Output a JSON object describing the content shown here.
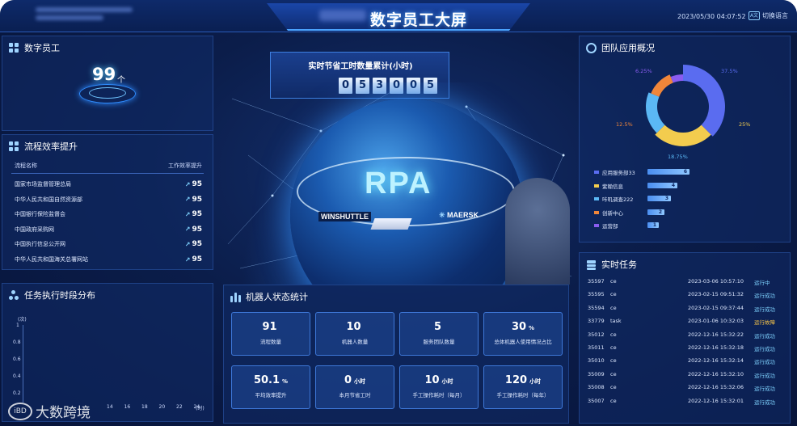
{
  "header": {
    "title": "数字员工大屏",
    "datetime": "2023/05/30 04:07:52",
    "lang_label": "切换语言",
    "lang_icon": "translate-icon"
  },
  "digital_workers": {
    "title": "数字员工",
    "count": "99",
    "unit": "个"
  },
  "process_efficiency": {
    "title": "流程效率提升",
    "columns": [
      "流程名称",
      "工作效率提升"
    ],
    "rows": [
      {
        "name": "国家市场监督管理总局",
        "value": "95"
      },
      {
        "name": "中华人民共和国自然资源部",
        "value": "95"
      },
      {
        "name": "中国银行保险监督会",
        "value": "95"
      },
      {
        "name": "中国政府采购网",
        "value": "95"
      },
      {
        "name": "中国执行信息公开网",
        "value": "95"
      },
      {
        "name": "中华人民共和国海关总署网站",
        "value": "95"
      }
    ]
  },
  "task_period": {
    "title": "任务执行时段分布",
    "chart_data": {
      "type": "line",
      "ylabel": "(次)",
      "y_ticks": [
        "1",
        "0.8",
        "0.6",
        "0.4",
        "0.2"
      ],
      "x_ticks": [
        "14",
        "16",
        "18",
        "20",
        "22",
        "24"
      ],
      "xlabel": "(时)",
      "ylim": [
        0,
        1
      ]
    }
  },
  "counter": {
    "title": "实时节省工时数量累计(小时)",
    "digits": [
      "0",
      "5",
      "3",
      "0",
      "0",
      "5"
    ]
  },
  "center": {
    "rpa_text": "RPA",
    "brand_left": "WINSHUTTLE",
    "brand_right": "MAERSK"
  },
  "robot_status": {
    "title": "机器人状态统计",
    "cards": [
      {
        "value": "91",
        "unit": "",
        "label": "流程数量"
      },
      {
        "value": "10",
        "unit": "",
        "label": "机器人数量"
      },
      {
        "value": "5",
        "unit": "",
        "label": "服务团队数量"
      },
      {
        "value": "30",
        "unit": "%",
        "label": "总体机器人使用情况占比"
      },
      {
        "value": "50.1",
        "unit": "%",
        "label": "平均效率提升"
      },
      {
        "value": "0",
        "unit": "小时",
        "label": "本月节省工时"
      },
      {
        "value": "10",
        "unit": "小时",
        "label": "手工操作耗时（每月）"
      },
      {
        "value": "120",
        "unit": "小时",
        "label": "手工操作耗时（每年）"
      }
    ]
  },
  "team_overview": {
    "title": "团队应用概况",
    "chart_data": {
      "type": "pie",
      "labels": [
        "应用服务部33",
        "紫翰信息",
        "咔叽调查222",
        "创新中心",
        "运营部"
      ],
      "values": [
        6,
        4,
        3,
        2,
        1
      ],
      "percent_labels": [
        "37.5%",
        "25%",
        "18.75%",
        "12.5%",
        "6.25%"
      ],
      "colors": [
        "#5a6cf0",
        "#f3cc4e",
        "#5bb8f5",
        "#f0863a",
        "#8a5cf0"
      ]
    }
  },
  "realtime_tasks": {
    "title": "实时任务",
    "rows": [
      {
        "id": "35597",
        "name": "ce",
        "time": "2023-03-06 10:57:10",
        "status": "运行中",
        "color": "#7fd3ff"
      },
      {
        "id": "35595",
        "name": "ce",
        "time": "2023-02-15 09:51:32",
        "status": "运行成功",
        "color": "#7fd3ff"
      },
      {
        "id": "35594",
        "name": "ce",
        "time": "2023-02-15 09:37:44",
        "status": "运行成功",
        "color": "#7fd3ff"
      },
      {
        "id": "33779",
        "name": "task",
        "time": "2023-01-06 10:32:03",
        "status": "运行故障",
        "color": "#f3c24a"
      },
      {
        "id": "35012",
        "name": "ce",
        "time": "2022-12-16 15:32:22",
        "status": "运行成功",
        "color": "#7fd3ff"
      },
      {
        "id": "35011",
        "name": "ce",
        "time": "2022-12-16 15:32:18",
        "status": "运行成功",
        "color": "#7fd3ff"
      },
      {
        "id": "35010",
        "name": "ce",
        "time": "2022-12-16 15:32:14",
        "status": "运行成功",
        "color": "#7fd3ff"
      },
      {
        "id": "35009",
        "name": "ce",
        "time": "2022-12-16 15:32:10",
        "status": "运行成功",
        "color": "#7fd3ff"
      },
      {
        "id": "35008",
        "name": "ce",
        "time": "2022-12-16 15:32:06",
        "status": "运行成功",
        "color": "#7fd3ff"
      },
      {
        "id": "35007",
        "name": "ce",
        "time": "2022-12-16 15:32:01",
        "status": "运行成功",
        "color": "#7fd3ff"
      }
    ]
  },
  "watermark": {
    "logo": "iBD",
    "text": "大数跨境"
  }
}
